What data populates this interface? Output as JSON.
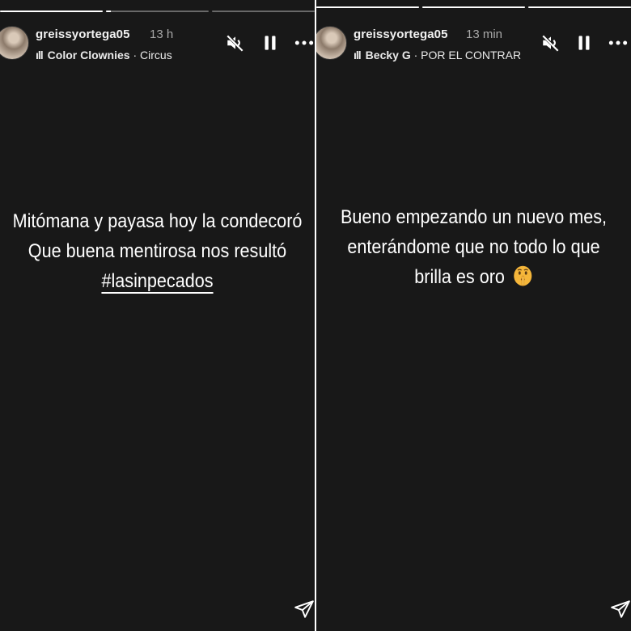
{
  "stories": [
    {
      "username": "greissyortega05",
      "time": "13 h",
      "music": {
        "artist": "Color Clownies",
        "separator": "·",
        "track": "Circus"
      },
      "progress": [
        1.0,
        0.05,
        0.0
      ],
      "caption": {
        "line1": "Mitómana y payasa hoy la condecoró",
        "line2": "Que buena mentirosa nos resultó",
        "hashtag": "#lasinpecados"
      }
    },
    {
      "username": "greissyortega05",
      "time": "13 min",
      "music": {
        "artist": "Becky G",
        "separator": "·",
        "track": "POR EL CONTRAR"
      },
      "progress": [
        1.0,
        1.0,
        1.0
      ],
      "caption": {
        "line1": "Bueno empezando un nuevo mes,",
        "line2": "enterándome que no todo lo que",
        "line3": "brilla es oro"
      }
    }
  ],
  "icons": {
    "mute": "speaker-muted-icon",
    "pause": "pause-icon",
    "more": "more-options-icon",
    "send": "send-icon",
    "emoji": "shushing-face-emoji"
  },
  "colors": {
    "background": "#181818",
    "text": "#ffffff",
    "muted_text": "#a8a8a8"
  }
}
